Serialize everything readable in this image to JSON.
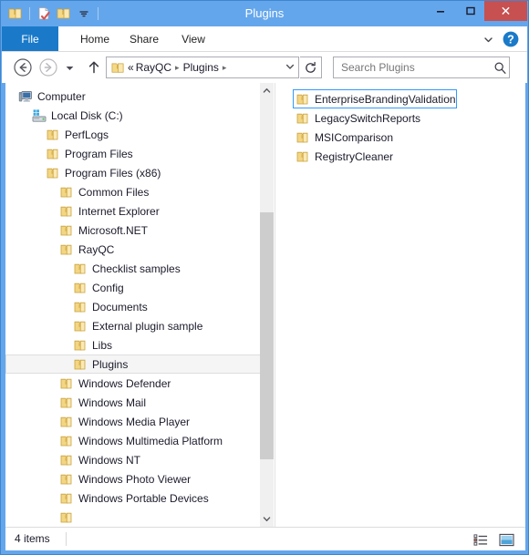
{
  "window": {
    "title": "Plugins",
    "accent_color": "#64a6ec",
    "close_color": "#c75050",
    "controls": {
      "minimize": "minimize-button",
      "maximize": "maximize-button",
      "close": "close-button"
    }
  },
  "quick_access": {
    "items": [
      {
        "icon": "folder-icon",
        "label": "Folder"
      },
      {
        "icon": "properties-icon",
        "label": "Properties"
      },
      {
        "icon": "new-folder-icon",
        "label": "New folder"
      },
      {
        "icon": "chevron-down-icon",
        "label": "Customize Quick Access Toolbar"
      }
    ]
  },
  "ribbon": {
    "tabs": [
      {
        "id": "file",
        "label": "File",
        "active": true
      },
      {
        "id": "home",
        "label": "Home",
        "active": false
      },
      {
        "id": "share",
        "label": "Share",
        "active": false
      },
      {
        "id": "view",
        "label": "View",
        "active": false
      }
    ],
    "expand_icon": "chevron-down-icon",
    "help_icon": "help-icon"
  },
  "navigation": {
    "back_icon": "back-arrow-icon",
    "forward_icon": "forward-arrow-icon",
    "recent_icon": "chevron-down-icon",
    "up_icon": "up-arrow-icon",
    "refresh_icon": "refresh-icon",
    "address_dropdown_icon": "chevron-down-icon",
    "address_folder_icon": "folder-icon",
    "breadcrumb": {
      "prefix": "«",
      "items": [
        "RayQC",
        "Plugins"
      ],
      "separator": "▸"
    }
  },
  "search": {
    "placeholder": "Search Plugins",
    "value": "",
    "icon": "search-icon"
  },
  "tree": {
    "items": [
      {
        "label": "Computer",
        "indent": 0,
        "icon": "computer-icon",
        "selected": false
      },
      {
        "label": "Local Disk (C:)",
        "indent": 1,
        "icon": "drive-icon",
        "selected": false
      },
      {
        "label": "PerfLogs",
        "indent": 2,
        "icon": "folder-icon",
        "selected": false
      },
      {
        "label": "Program Files",
        "indent": 2,
        "icon": "folder-icon",
        "selected": false
      },
      {
        "label": "Program Files (x86)",
        "indent": 2,
        "icon": "folder-icon",
        "selected": false
      },
      {
        "label": "Common Files",
        "indent": 3,
        "icon": "folder-icon",
        "selected": false
      },
      {
        "label": "Internet Explorer",
        "indent": 3,
        "icon": "folder-icon",
        "selected": false
      },
      {
        "label": "Microsoft.NET",
        "indent": 3,
        "icon": "folder-icon",
        "selected": false
      },
      {
        "label": "RayQC",
        "indent": 3,
        "icon": "folder-icon",
        "selected": false
      },
      {
        "label": "Checklist samples",
        "indent": 4,
        "icon": "folder-icon",
        "selected": false
      },
      {
        "label": "Config",
        "indent": 4,
        "icon": "folder-icon",
        "selected": false
      },
      {
        "label": "Documents",
        "indent": 4,
        "icon": "folder-icon",
        "selected": false
      },
      {
        "label": "External plugin sample",
        "indent": 4,
        "icon": "folder-icon",
        "selected": false
      },
      {
        "label": "Libs",
        "indent": 4,
        "icon": "folder-icon",
        "selected": false
      },
      {
        "label": "Plugins",
        "indent": 4,
        "icon": "folder-icon",
        "selected": true
      },
      {
        "label": "Windows Defender",
        "indent": 3,
        "icon": "folder-icon",
        "selected": false
      },
      {
        "label": "Windows Mail",
        "indent": 3,
        "icon": "folder-icon",
        "selected": false
      },
      {
        "label": "Windows Media Player",
        "indent": 3,
        "icon": "folder-icon",
        "selected": false
      },
      {
        "label": "Windows Multimedia Platform",
        "indent": 3,
        "icon": "folder-icon",
        "selected": false
      },
      {
        "label": "Windows NT",
        "indent": 3,
        "icon": "folder-icon",
        "selected": false
      },
      {
        "label": "Windows Photo Viewer",
        "indent": 3,
        "icon": "folder-icon",
        "selected": false
      },
      {
        "label": "Windows Portable Devices",
        "indent": 3,
        "icon": "folder-icon",
        "selected": false
      }
    ],
    "scrollbar": {
      "up_icon": "chevron-up-icon",
      "down_icon": "chevron-down-icon"
    }
  },
  "files": {
    "items": [
      {
        "name": "EnterpriseBrandingValidation",
        "icon": "folder-icon",
        "focused": true
      },
      {
        "name": "LegacySwitchReports",
        "icon": "folder-icon",
        "focused": false
      },
      {
        "name": "MSIComparison",
        "icon": "folder-icon",
        "focused": false
      },
      {
        "name": "RegistryCleaner",
        "icon": "folder-icon",
        "focused": false
      }
    ]
  },
  "status": {
    "item_count_text": "4 items",
    "view_buttons": [
      {
        "id": "details",
        "icon": "details-view-icon",
        "active": true
      },
      {
        "id": "icons",
        "icon": "large-icons-view-icon",
        "active": false
      }
    ]
  }
}
